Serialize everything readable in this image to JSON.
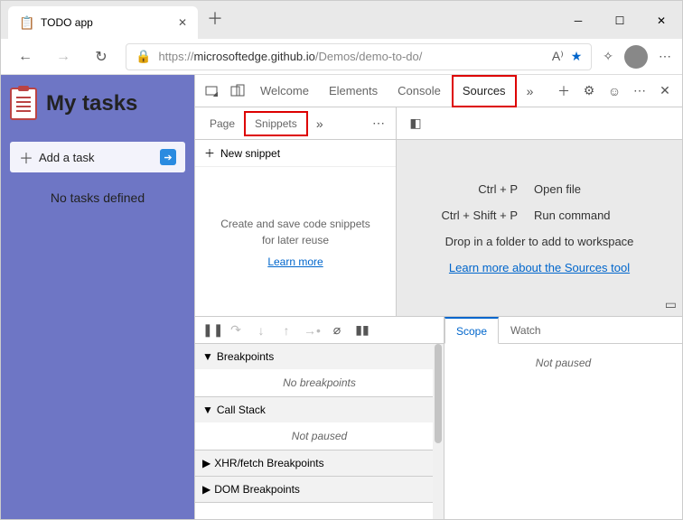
{
  "browser": {
    "tab_title": "TODO app",
    "url_prefix": "https://",
    "url_host": "microsoftedge.github.io",
    "url_path": "/Demos/demo-to-do/"
  },
  "page": {
    "title": "My tasks",
    "add_task": "Add a task",
    "no_tasks": "No tasks defined"
  },
  "devtools": {
    "tabs": {
      "welcome": "Welcome",
      "elements": "Elements",
      "console": "Console",
      "sources": "Sources"
    },
    "subtabs": {
      "page": "Page",
      "snippets": "Snippets"
    },
    "new_snippet": "New snippet",
    "snippet_empty_msg": "Create and save code snippets for later reuse",
    "snippet_learn_more": "Learn more",
    "editor": {
      "kb1": "Ctrl + P",
      "kb1_label": "Open file",
      "kb2": "Ctrl + Shift + P",
      "kb2_label": "Run command",
      "drop_msg": "Drop in a folder to add to workspace",
      "learn_link": "Learn more about the Sources tool"
    },
    "debug": {
      "breakpoints": "Breakpoints",
      "no_breakpoints": "No breakpoints",
      "call_stack": "Call Stack",
      "not_paused": "Not paused",
      "xhr": "XHR/fetch Breakpoints",
      "dom": "DOM Breakpoints"
    },
    "scope": {
      "scope": "Scope",
      "watch": "Watch",
      "not_paused": "Not paused"
    }
  }
}
